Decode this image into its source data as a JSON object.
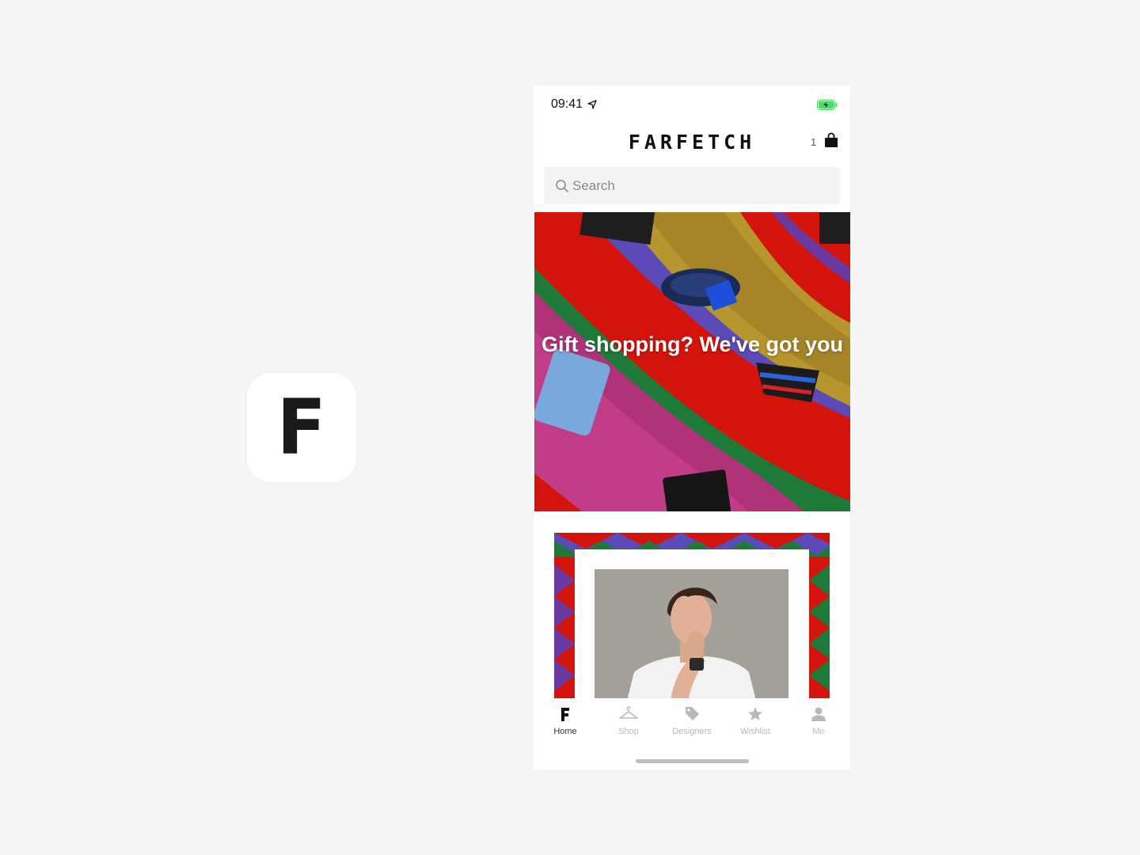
{
  "app_icon": {
    "letter": "F"
  },
  "status_bar": {
    "time": "09:41",
    "icons": [
      "location-icon",
      "battery-charging-icon"
    ]
  },
  "header": {
    "brand": "FARFETCH",
    "bag_count": "1"
  },
  "search": {
    "placeholder": "Search"
  },
  "hero": {
    "headline": "Gift shopping? We've got you"
  },
  "tabs": [
    {
      "label": "Home",
      "icon": "farfetch-f-icon",
      "active": true
    },
    {
      "label": "Shop",
      "icon": "hanger-icon",
      "active": false
    },
    {
      "label": "Designers",
      "icon": "tag-icon",
      "active": false
    },
    {
      "label": "Wishlist",
      "icon": "star-icon",
      "active": false
    },
    {
      "label": "Me",
      "icon": "person-icon",
      "active": false
    }
  ],
  "colors": {
    "hero_red": "#d3140c",
    "tab_active": "#333333",
    "tab_inactive": "#b9b9b9"
  }
}
